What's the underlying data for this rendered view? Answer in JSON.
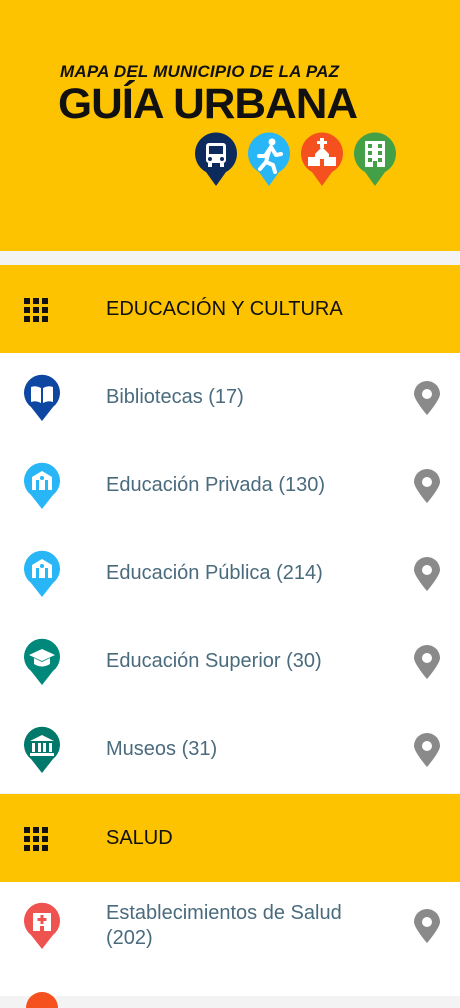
{
  "app": {
    "subtitle": "MAPA DEL MUNICIPIO DE LA PAZ",
    "title": "GUÍA URBANA",
    "logo_icons": [
      "bus-icon",
      "pedestrian-icon",
      "church-icon",
      "building-icon"
    ]
  },
  "sections": [
    {
      "title": "EDUCACIÓN Y CULTURA",
      "items": [
        {
          "label": "Bibliotecas (17)",
          "icon": "book-pin-icon",
          "color": "#0D47A1"
        },
        {
          "label": "Educación Privada (130)",
          "icon": "school-pin-icon",
          "color": "#29B6F6"
        },
        {
          "label": "Educación Pública (214)",
          "icon": "school-pin-icon",
          "color": "#29B6F6"
        },
        {
          "label": "Educación Superior (30)",
          "icon": "graduation-cap-pin-icon",
          "color": "#00897B"
        },
        {
          "label": "Museos (31)",
          "icon": "museum-pin-icon",
          "color": "#00796B"
        }
      ]
    },
    {
      "title": "SALUD",
      "items": [
        {
          "label": "Establecimientos de Salud (202)",
          "icon": "hospital-pin-icon",
          "color": "#EF5350"
        }
      ]
    }
  ],
  "colors": {
    "brand_yellow": "#FDC300",
    "label_text": "#4a6b7d",
    "location_icon": "#8a8a8a"
  }
}
